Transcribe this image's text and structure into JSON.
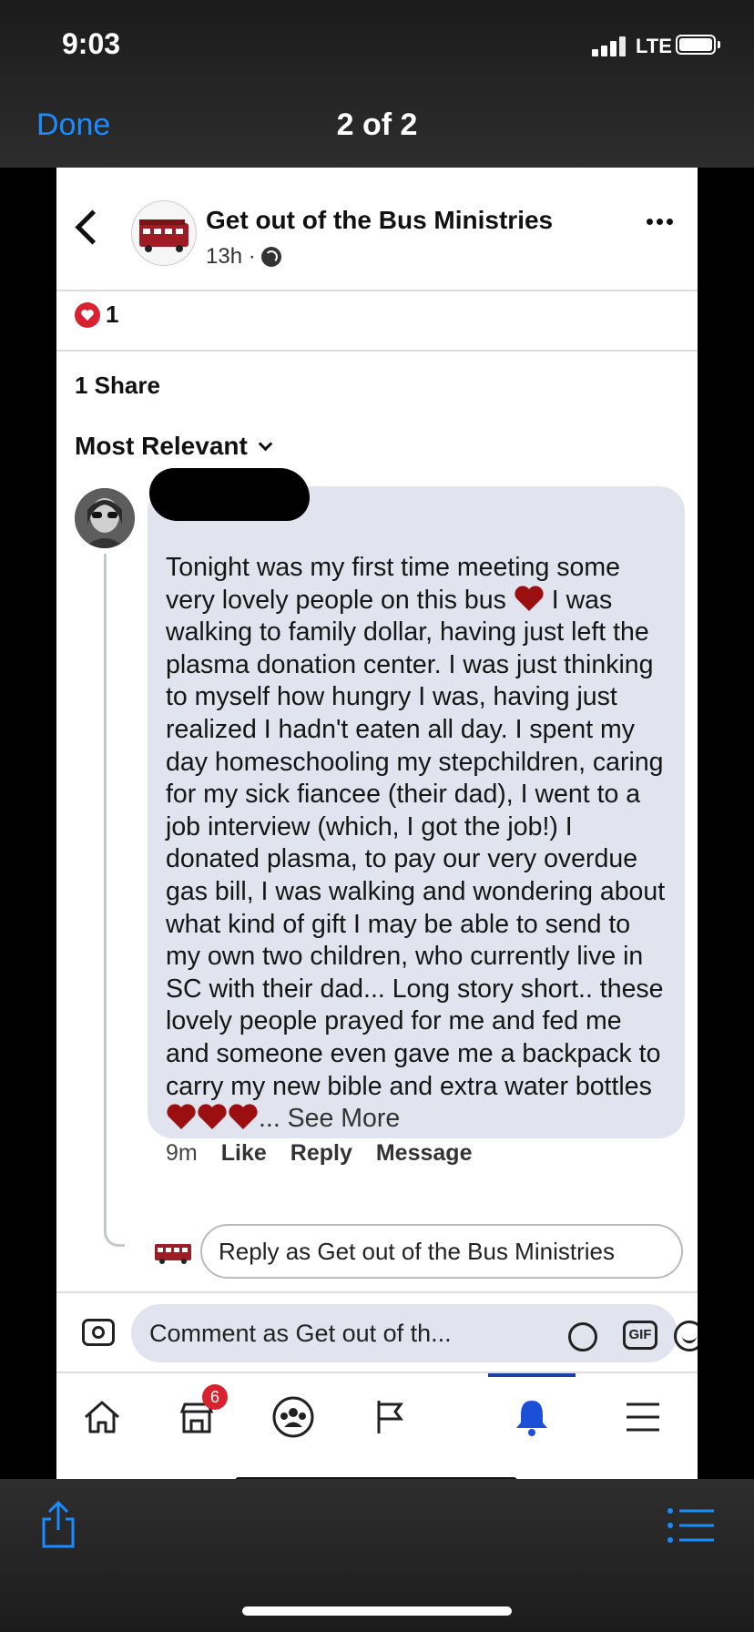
{
  "status_bar": {
    "time": "9:03",
    "network": "LTE"
  },
  "viewer": {
    "done_label": "Done",
    "pager": "2 of 2"
  },
  "post": {
    "page_name": "Get out of the Bus Ministries",
    "age": "13h ·",
    "reaction_count": "1",
    "share_count": "1 Share",
    "sort_label": "Most Relevant"
  },
  "comment": {
    "text": "Tonight was my first time meeting some very lovely people on this bus ",
    "text_2": " I was walking to family dollar, having just left the plasma donation center. I was just thinking to myself how hungry I was, having just realized I hadn't eaten all day. I spent my day homeschooling my stepchildren, caring for my sick fiancee (their dad), I went to a job interview (which, I got the job!) I donated plasma, to pay our very overdue gas bill, I was walking and wondering about what kind of gift I may be able to send to my own two children, who currently live in SC with their dad... Long story short.. these lovely people prayed for me and fed me and someone even gave me a backpack to carry my new bible and extra water bottles ",
    "see_more": "... See More",
    "time": "9m",
    "like": "Like",
    "reply": "Reply",
    "message": "Message",
    "reply_placeholder": "Reply as Get out of the Bus Ministries"
  },
  "composer": {
    "placeholder": "Comment as Get out of th...",
    "gif_label": "GIF"
  },
  "tabbar": {
    "items": [
      "home-icon",
      "marketplace-icon",
      "groups-icon",
      "pages-flag-icon",
      "notifications-bell-icon",
      "menu-icon"
    ],
    "marketplace_badge": "6",
    "active": "notifications"
  },
  "colors": {
    "accent_blue": "#1a8cff",
    "fb_blue": "#1b3fa8",
    "heart_red": "#9b0f10",
    "bubble": "#e1e4ee"
  }
}
